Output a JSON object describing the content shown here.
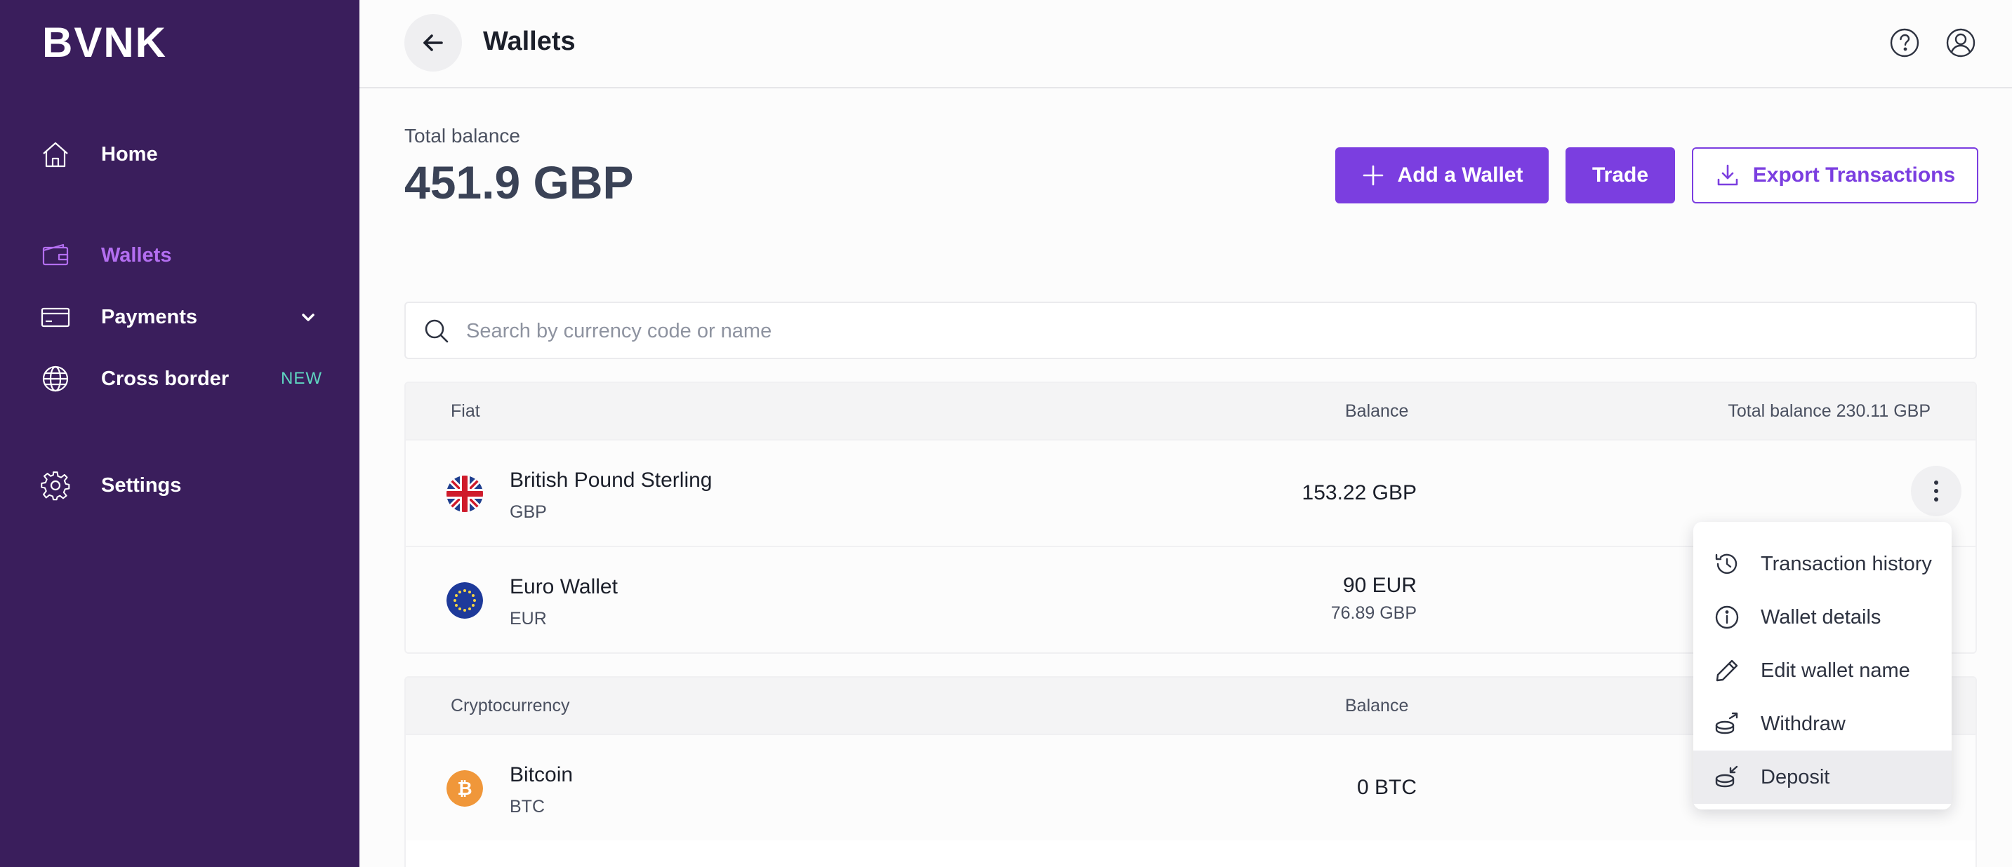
{
  "app": {
    "logo": "BVNK"
  },
  "sidebar": {
    "items": [
      {
        "label": "Home",
        "icon": "home-icon"
      },
      {
        "label": "Wallets",
        "icon": "wallet-icon",
        "active": true
      },
      {
        "label": "Payments",
        "icon": "card-icon",
        "expandable": true
      },
      {
        "label": "Cross border",
        "icon": "globe-icon",
        "badge": "NEW"
      },
      {
        "label": "Settings",
        "icon": "gear-icon"
      }
    ]
  },
  "header": {
    "title": "Wallets",
    "back_icon": "arrow-left-icon",
    "help_icon": "help-icon",
    "user_icon": "user-icon"
  },
  "balance": {
    "label": "Total balance",
    "value": "451.9 GBP"
  },
  "actions": {
    "add_wallet": "Add a Wallet",
    "trade": "Trade",
    "export": "Export Transactions"
  },
  "search": {
    "placeholder": "Search by currency code or name",
    "value": ""
  },
  "fiat": {
    "header": {
      "category": "Fiat",
      "balance": "Balance",
      "total": "Total balance 230.11 GBP"
    },
    "rows": [
      {
        "name": "British Pound Sterling",
        "code": "GBP",
        "balance": "153.22 GBP",
        "flag": "uk-flag-icon"
      },
      {
        "name": "Euro Wallet",
        "code": "EUR",
        "balance": "90 EUR",
        "balance_secondary": "76.89 GBP",
        "flag": "eu-flag-icon"
      }
    ]
  },
  "crypto": {
    "header": {
      "category": "Cryptocurrency",
      "balance": "Balance"
    },
    "rows": [
      {
        "name": "Bitcoin",
        "code": "BTC",
        "balance": "0 BTC",
        "flag": "bitcoin-icon"
      }
    ]
  },
  "menu": {
    "items": [
      {
        "label": "Transaction history",
        "icon": "history-icon"
      },
      {
        "label": "Wallet details",
        "icon": "info-icon"
      },
      {
        "label": "Edit wallet name",
        "icon": "pencil-icon"
      },
      {
        "label": "Withdraw",
        "icon": "withdraw-icon"
      },
      {
        "label": "Deposit",
        "icon": "deposit-icon",
        "highlighted": true
      }
    ]
  },
  "colors": {
    "sidebar_bg": "#3a1e5c",
    "accent": "#7b3ee0",
    "active_nav": "#b36ef0",
    "badge": "#5fd6c1"
  }
}
